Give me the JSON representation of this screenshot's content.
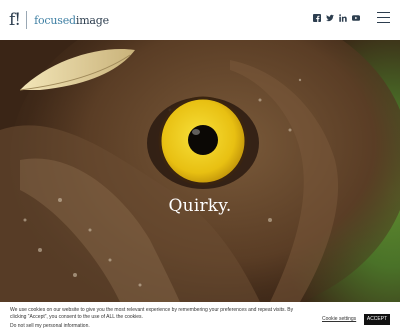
{
  "header": {
    "logo_mark": "f!",
    "logo_text_part1": "focused",
    "logo_text_part2": "image",
    "social_icons": [
      "facebook-icon",
      "twitter-icon",
      "linkedin-icon",
      "youtube-icon"
    ],
    "menu_icon": "hamburger-menu-icon"
  },
  "hero": {
    "title": "Quirky."
  },
  "cookie": {
    "message": "We use cookies on our website to give you the most relevant experience by remembering your preferences and repeat visits. By clicking “Accept”, you consent to the use of ALL the cookies.",
    "do_not_sell": "Do not sell my personal information.",
    "settings_label": "Cookie settings",
    "accept_label": "ACCEPT"
  },
  "colors": {
    "brand_dark": "#2d3e4f",
    "brand_blue": "#3e7fa3",
    "accept_bg": "#111111"
  }
}
